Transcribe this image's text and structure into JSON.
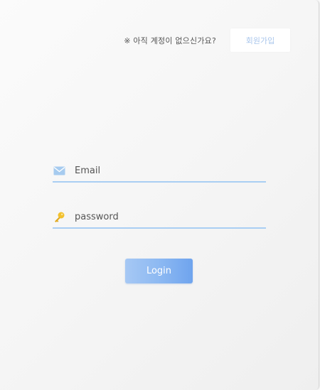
{
  "header": {
    "signup_prompt": "※ 아직 계정이 없으신가요?",
    "signup_label": "회원가입"
  },
  "form": {
    "email": {
      "placeholder": "Email",
      "value": "",
      "icon": "envelope-icon"
    },
    "password": {
      "placeholder": "password",
      "value": "",
      "icon": "key-icon"
    },
    "login_label": "Login"
  },
  "colors": {
    "accent": "#a9cef3",
    "button_gradient_start": "#a6c8f4",
    "button_gradient_end": "#6fa4ee",
    "signup_text": "#a9c6ec",
    "key_icon": "#f2c12e",
    "envelope_icon": "#a6cbef"
  }
}
